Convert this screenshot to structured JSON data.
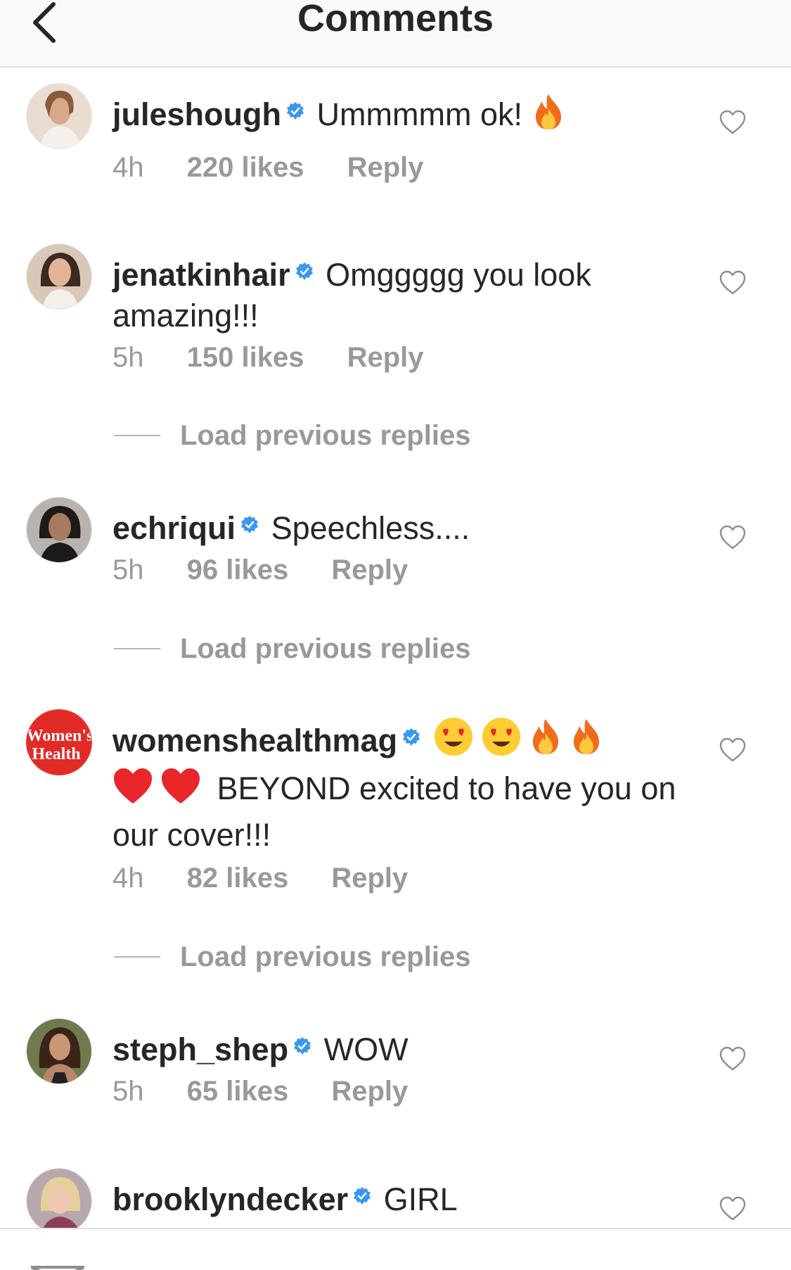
{
  "header": {
    "title": "Comments"
  },
  "icons": {
    "back": "chevron-left-icon",
    "verified": "verified-badge-icon",
    "like": "heart-outline-icon"
  },
  "colors": {
    "verified_blue": "#3897f0",
    "meta_gray": "#999999",
    "text": "#262626"
  },
  "comments": [
    {
      "username": "juleshough",
      "text": "Ummmmm ok!",
      "emoji_suffix": [
        "fire"
      ],
      "time": "4h",
      "likes": "220 likes",
      "reply": "Reply"
    },
    {
      "username": "jenatkinhair",
      "text": "Omggggg you look amazing!!!",
      "time": "5h",
      "likes": "150 likes",
      "reply": "Reply"
    },
    {
      "username": "echriqui",
      "text": "Speechless....",
      "time": "5h",
      "likes": "96 likes",
      "reply": "Reply"
    },
    {
      "username": "womenshealthmag",
      "emoji_prefix": [
        "heart-eyes",
        "heart-eyes",
        "fire",
        "fire",
        "red-heart",
        "red-heart"
      ],
      "text": "BEYOND excited to have you on our cover!!!",
      "time": "4h",
      "likes": "82 likes",
      "reply": "Reply",
      "avatar_text": [
        "Women's",
        "Health"
      ]
    },
    {
      "username": "steph_shep",
      "text": "WOW",
      "time": "5h",
      "likes": "65 likes",
      "reply": "Reply"
    },
    {
      "username": "brooklyndecker",
      "text": "GIRL"
    }
  ],
  "load_previous_label": "Load previous replies"
}
